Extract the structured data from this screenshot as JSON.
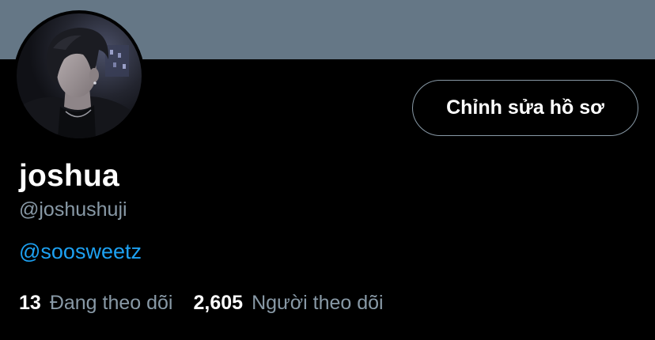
{
  "profile": {
    "display_name": "joshua",
    "handle": "@joshushuji",
    "bio_link": "@soosweetz"
  },
  "actions": {
    "edit_profile_label": "Chỉnh sửa hồ sơ"
  },
  "stats": {
    "following_count": "13",
    "following_label": "Đang theo dõi",
    "followers_count": "2,605",
    "followers_label": "Người theo dõi"
  },
  "colors": {
    "background": "#000000",
    "banner": "#657786",
    "primary_text": "#ffffff",
    "secondary_text": "#8899a6",
    "link": "#1da1f2",
    "button_border": "#8899a6"
  }
}
